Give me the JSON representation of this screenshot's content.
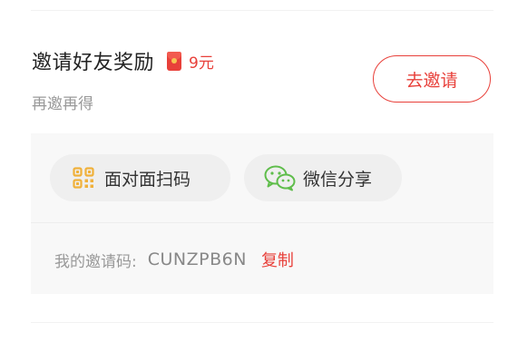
{
  "invite": {
    "title": "邀请好友奖励",
    "reward": "9元",
    "subtitle": "再邀再得",
    "button_label": "去邀请"
  },
  "share": {
    "scan_label": "面对面扫码",
    "wechat_label": "微信分享"
  },
  "code": {
    "label": "我的邀请码:",
    "value": "CUNZPB6N",
    "copy_label": "复制"
  },
  "icons": {
    "reward": "red-envelope-icon",
    "scan": "qrcode-icon",
    "wechat": "wechat-icon"
  },
  "colors": {
    "accent": "#e8403a",
    "qrcode": "#f0b13b",
    "wechat": "#5fbd4b",
    "panel_bg": "#f8f8f8",
    "pill_bg": "#efefef"
  }
}
